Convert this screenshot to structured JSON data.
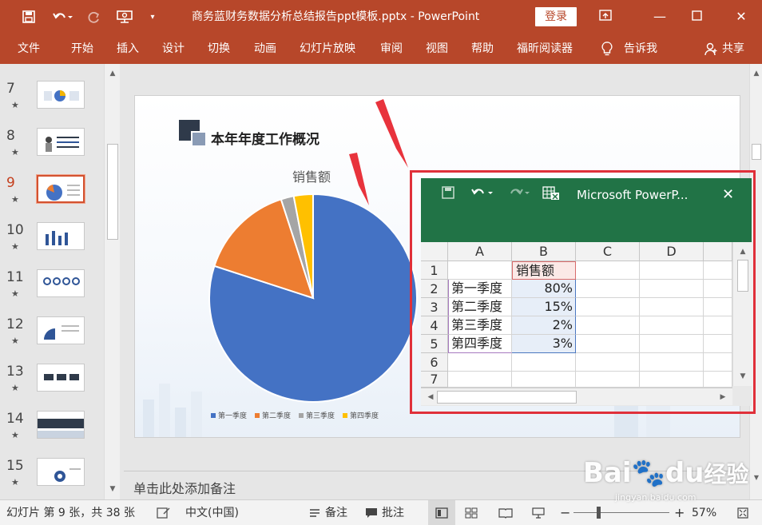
{
  "titlebar": {
    "title": "商务蓝财务数据分析总结报告ppt模板.pptx  -  PowerPoint",
    "login": "登录",
    "icons": [
      "save-icon",
      "undo-icon",
      "redo-icon",
      "present-icon",
      "customize-icon"
    ]
  },
  "ribbon": {
    "tabs": [
      "文件",
      "开始",
      "插入",
      "设计",
      "切换",
      "动画",
      "幻灯片放映",
      "审阅",
      "视图",
      "帮助",
      "福昕阅读器"
    ],
    "tell_me": "告诉我",
    "share": "共享"
  },
  "thumbnails": [
    {
      "num": "7",
      "star": "★"
    },
    {
      "num": "8",
      "star": "★"
    },
    {
      "num": "9",
      "star": "★",
      "active": true
    },
    {
      "num": "10",
      "star": "★"
    },
    {
      "num": "11",
      "star": "★"
    },
    {
      "num": "12",
      "star": "★"
    },
    {
      "num": "13",
      "star": "★"
    },
    {
      "num": "14",
      "star": "★"
    },
    {
      "num": "15",
      "star": "★"
    }
  ],
  "slide": {
    "title": "本年年度工作概况"
  },
  "chart_data": {
    "type": "pie",
    "title": "销售额",
    "categories": [
      "第一季度",
      "第二季度",
      "第三季度",
      "第四季度"
    ],
    "values": [
      80,
      15,
      2,
      3
    ],
    "colors": [
      "#4472c4",
      "#ed7d31",
      "#a5a5a5",
      "#ffc000"
    ],
    "legend": "bottom"
  },
  "excel": {
    "caption": "Microsoft PowerP...",
    "columns": [
      "A",
      "B",
      "C",
      "D"
    ],
    "rows": [
      "1",
      "2",
      "3",
      "4",
      "5",
      "6",
      "7"
    ],
    "header_cell": "销售额",
    "row_labels": [
      "第一季度",
      "第二季度",
      "第三季度",
      "第四季度"
    ],
    "row_values": [
      "80%",
      "15%",
      "2%",
      "3%"
    ]
  },
  "notes": {
    "placeholder": "单击此处添加备注"
  },
  "statusbar": {
    "slide_info": "幻灯片 第 9 张，共 38 张",
    "language": "中文(中国)",
    "notes": "备注",
    "comments": "批注",
    "zoom": "57%",
    "zoom_level": 0.57
  },
  "watermark": {
    "text": "Bai",
    "text2": "du",
    "text3": "经验",
    "url": "jingyan.baidu.com"
  }
}
